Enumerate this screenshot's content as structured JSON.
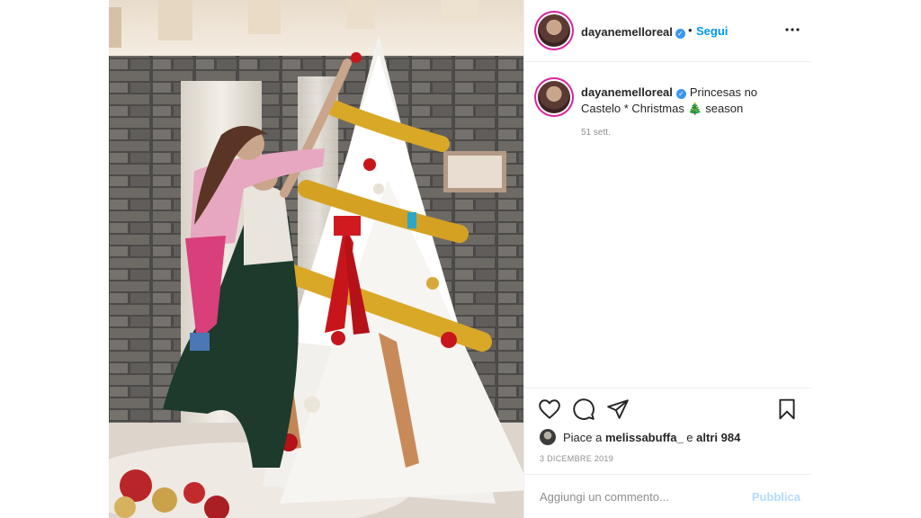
{
  "post": {
    "username": "dayanemelloreal",
    "follow_label": "Segui",
    "separator": "•",
    "caption_text": "Princesas no Castelo * Christmas 🎄 season",
    "time_ago": "51 sett.",
    "likes_prefix": "Piace a ",
    "likes_user": "melissabuffa_",
    "likes_middle": " e ",
    "likes_others": "altri 984",
    "date": "3 DICEMBRE 2019",
    "comment_placeholder": "Aggiungi un commento...",
    "publish_label": "Pubblica"
  },
  "colors": {
    "accent": "#0095f6",
    "publish_disabled": "#b3dbff",
    "verified": "#3897f0",
    "muted": "#8e8e8e"
  },
  "icons": [
    "verified-badge-icon",
    "more-options-icon",
    "heart-icon",
    "comment-icon",
    "share-icon",
    "save-icon"
  ]
}
